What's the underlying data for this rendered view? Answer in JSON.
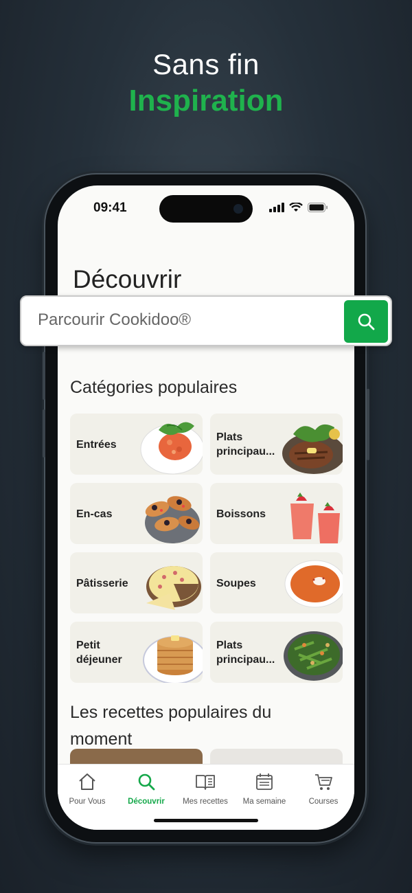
{
  "headline": {
    "line1": "Sans fin",
    "line2": "Inspiration"
  },
  "status_bar": {
    "time": "09:41"
  },
  "page": {
    "title": "Découvrir"
  },
  "search": {
    "placeholder": "Parcourir Cookidoo®"
  },
  "categories": {
    "title": "Catégories populaires",
    "items": [
      {
        "label": "Entrées",
        "image": "salmon-tartare"
      },
      {
        "label": "Plats principau...",
        "image": "steak-salad"
      },
      {
        "label": "En-cas",
        "image": "olive-crostini"
      },
      {
        "label": "Boissons",
        "image": "strawberry-smoothies"
      },
      {
        "label": "Pâtisserie",
        "image": "quiche"
      },
      {
        "label": "Soupes",
        "image": "tomato-soup"
      },
      {
        "label": "Petit déjeuner",
        "image": "pancakes"
      },
      {
        "label": "Plats principau...",
        "image": "green-bean-salad"
      }
    ]
  },
  "popular_recipes": {
    "title": "Les recettes populaires du moment"
  },
  "tabbar": {
    "items": [
      {
        "label": "Pour Vous",
        "icon": "home-icon",
        "active": false
      },
      {
        "label": "Découvrir",
        "icon": "search-icon",
        "active": true
      },
      {
        "label": "Mes recettes",
        "icon": "book-icon",
        "active": false
      },
      {
        "label": "Ma semaine",
        "icon": "calendar-icon",
        "active": false
      },
      {
        "label": "Courses",
        "icon": "cart-icon",
        "active": false
      }
    ]
  },
  "colors": {
    "accent": "#12a84a",
    "headline_accent": "#1fb24d",
    "card_bg": "#f1f0e9"
  }
}
